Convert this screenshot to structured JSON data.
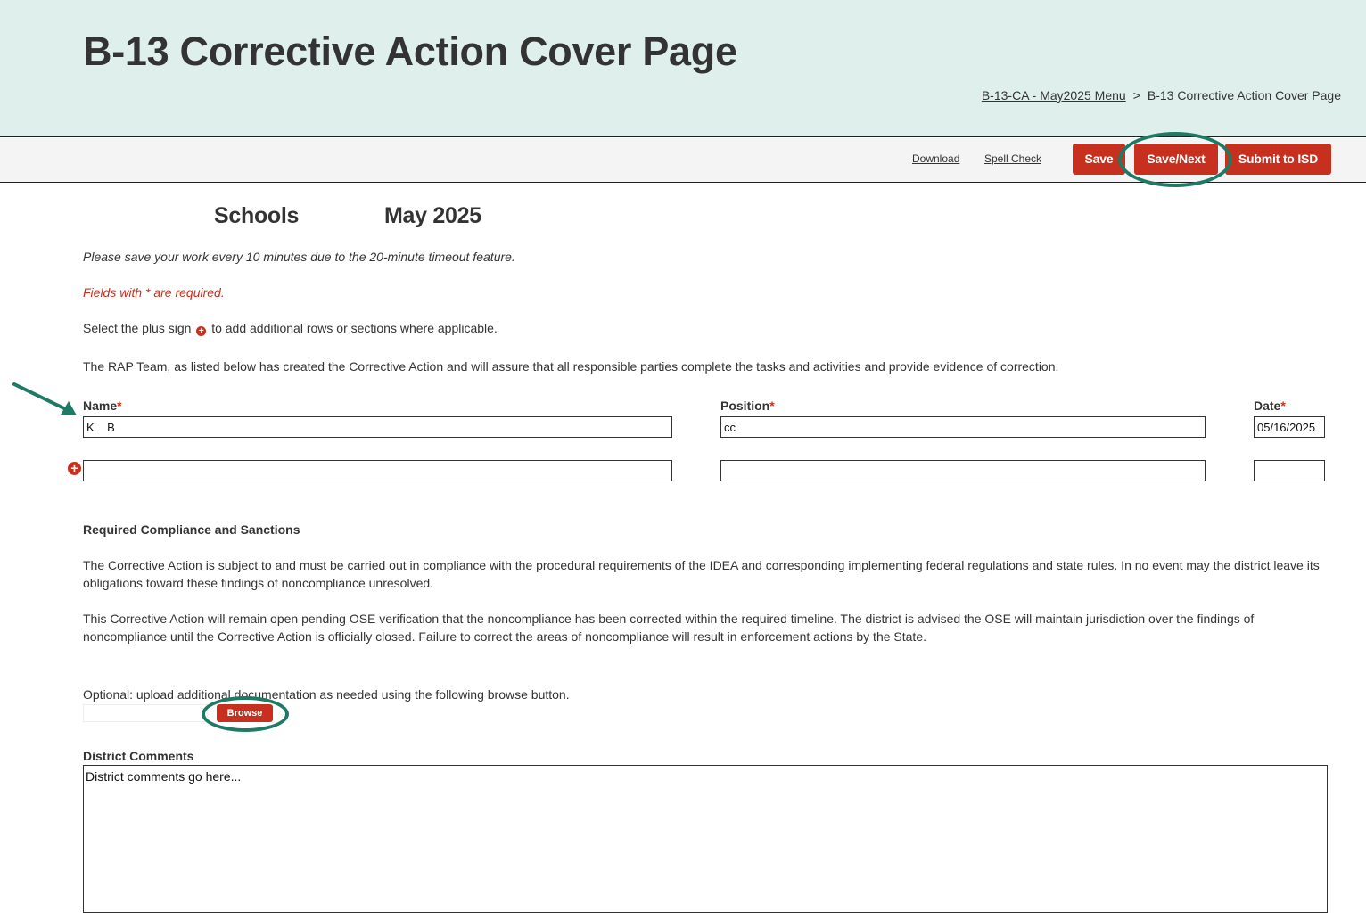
{
  "header": {
    "title": "B-13 Corrective Action Cover Page",
    "breadcrumb": {
      "parent": "B-13-CA - May2025 Menu",
      "separator": ">",
      "current": "B-13 Corrective Action Cover Page"
    }
  },
  "toolbar": {
    "download": "Download",
    "spell_check": "Spell Check",
    "save": "Save",
    "save_next": "Save/Next",
    "submit": "Submit to ISD"
  },
  "subtitle": {
    "schools": "Schools",
    "period": "May 2025"
  },
  "notes": {
    "save_warning": "Please save your work every 10 minutes due to the 20-minute timeout feature.",
    "required": "Fields with * are required.",
    "plus_before": "Select the plus sign",
    "plus_after": "to add additional rows or sections where applicable.",
    "rap_team": "The RAP Team, as listed below has created the Corrective Action and will assure that all responsible parties complete the tasks and activities and provide evidence of correction."
  },
  "team_table": {
    "name_label": "Name",
    "position_label": "Position",
    "date_label": "Date",
    "required_mark": "*",
    "rows": [
      {
        "name": "K    B",
        "position": "cc",
        "date": "05/16/2025"
      },
      {
        "name": "",
        "position": "",
        "date": ""
      }
    ]
  },
  "compliance": {
    "heading": "Required Compliance and Sanctions",
    "para1": "The Corrective Action is subject to and must be carried out in compliance with the procedural requirements of the IDEA and corresponding implementing federal regulations and state rules. In no event may the district leave its obligations toward these findings of noncompliance unresolved.",
    "para2": "This Corrective Action will remain open pending OSE verification that the noncompliance has been corrected within the required timeline. The district is advised the OSE will maintain jurisdiction over the findings of noncompliance until the Corrective Action is officially closed. Failure to correct the areas of noncompliance will result in enforcement actions by the State."
  },
  "upload": {
    "instruction": "Optional: upload additional documentation as needed using the following browse button.",
    "browse": "Browse"
  },
  "comments": {
    "label": "District Comments",
    "value": "District comments go here..."
  },
  "colors": {
    "header_bg": "#dff0ec",
    "accent_red": "#c7301f",
    "annotation_green": "#1e7a64"
  }
}
